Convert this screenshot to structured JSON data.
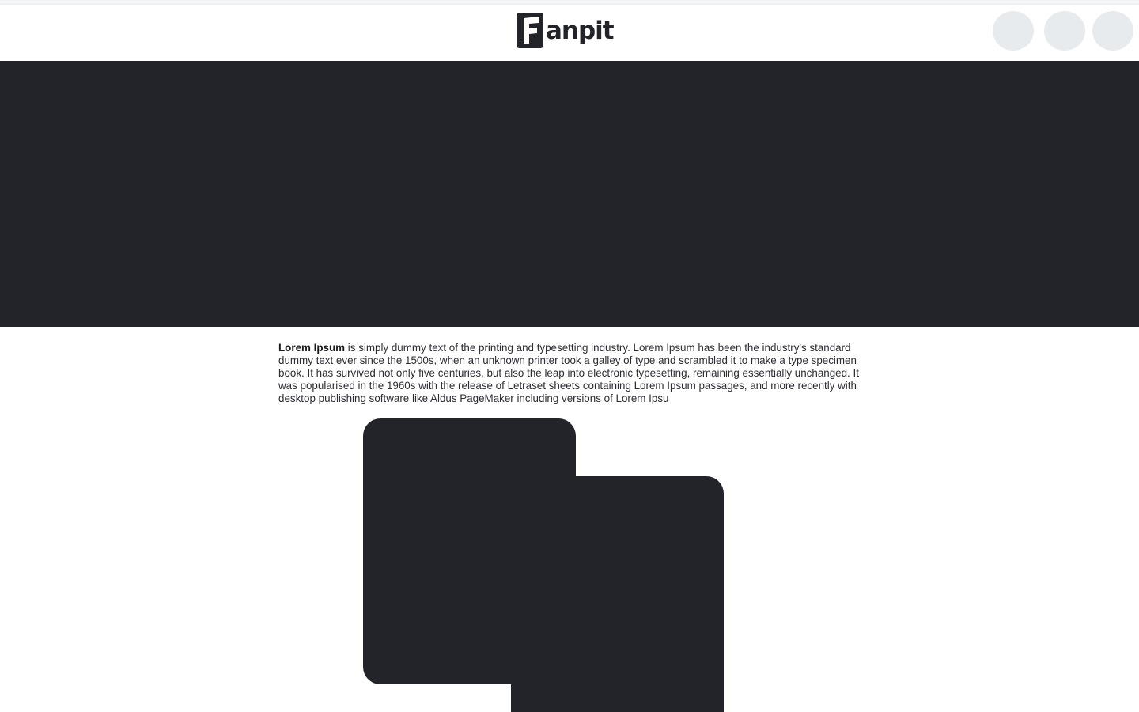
{
  "header": {
    "logo_text": "anpit",
    "actions": [
      {
        "name": "header-action-1"
      },
      {
        "name": "header-action-2"
      },
      {
        "name": "header-action-3"
      }
    ]
  },
  "article": {
    "lead": "Lorem Ipsum",
    "body": " is simply dummy text of the printing and typesetting industry. Lorem Ipsum has been the industry's standard dummy text ever since the 1500s, when an unknown printer took a galley of type and scrambled it to make a type specimen book. It has survived not only five centuries, but also the leap into electronic typesetting, remaining essentially unchanged. It was popularised in the 1960s with the release of Letraset sheets containing Lorem Ipsum passages, and more recently with desktop publishing software like Aldus PageMaker including versions of Lorem Ipsu"
  },
  "colors": {
    "dark": "#222429",
    "button_bg": "#e8ebee",
    "text": "#2a2d33"
  }
}
